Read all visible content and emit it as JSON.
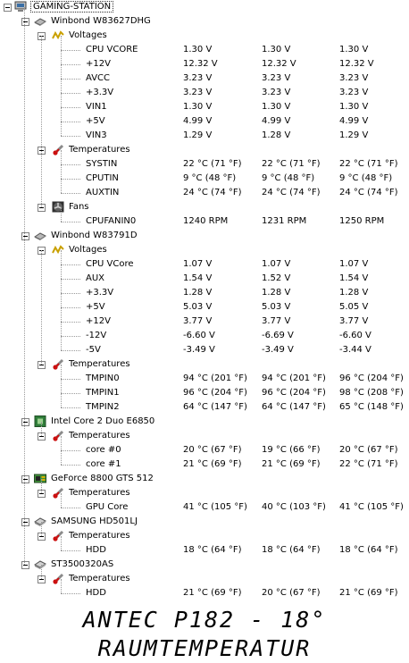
{
  "root": {
    "label": "GAMING-STATION",
    "icon": "computer-icon"
  },
  "devices": [
    {
      "name": "Winbond W83627DHG",
      "icon": "chip-icon",
      "groups": [
        {
          "name": "Voltages",
          "icon": "voltage-icon",
          "rows": [
            [
              "CPU VCORE",
              "1.30 V",
              "1.30 V",
              "1.30 V"
            ],
            [
              "+12V",
              "12.32 V",
              "12.32 V",
              "12.32 V"
            ],
            [
              "AVCC",
              "3.23 V",
              "3.23 V",
              "3.23 V"
            ],
            [
              "+3.3V",
              "3.23 V",
              "3.23 V",
              "3.23 V"
            ],
            [
              "VIN1",
              "1.30 V",
              "1.30 V",
              "1.30 V"
            ],
            [
              "+5V",
              "4.99 V",
              "4.99 V",
              "4.99 V"
            ],
            [
              "VIN3",
              "1.29 V",
              "1.28 V",
              "1.29 V"
            ]
          ]
        },
        {
          "name": "Temperatures",
          "icon": "thermometer-icon",
          "rows": [
            [
              "SYSTIN",
              "22 °C  (71 °F)",
              "22 °C  (71 °F)",
              "22 °C  (71 °F)"
            ],
            [
              "CPUTIN",
              "9 °C  (48 °F)",
              "9 °C  (48 °F)",
              "9 °C  (48 °F)"
            ],
            [
              "AUXTIN",
              "24 °C  (74 °F)",
              "24 °C  (74 °F)",
              "24 °C  (74 °F)"
            ]
          ]
        },
        {
          "name": "Fans",
          "icon": "fan-icon",
          "rows": [
            [
              "CPUFANIN0",
              "1240 RPM",
              "1231 RPM",
              "1250 RPM"
            ]
          ]
        }
      ]
    },
    {
      "name": "Winbond W83791D",
      "icon": "chip-icon",
      "groups": [
        {
          "name": "Voltages",
          "icon": "voltage-icon",
          "rows": [
            [
              "CPU VCore",
              "1.07 V",
              "1.07 V",
              "1.07 V"
            ],
            [
              "AUX",
              "1.54 V",
              "1.52 V",
              "1.54 V"
            ],
            [
              "+3.3V",
              "1.28 V",
              "1.28 V",
              "1.28 V"
            ],
            [
              "+5V",
              "5.03 V",
              "5.03 V",
              "5.05 V"
            ],
            [
              "+12V",
              "3.77 V",
              "3.77 V",
              "3.77 V"
            ],
            [
              "-12V",
              "-6.60 V",
              "-6.69 V",
              "-6.60 V"
            ],
            [
              "-5V",
              "-3.49 V",
              "-3.49 V",
              "-3.44 V"
            ]
          ]
        },
        {
          "name": "Temperatures",
          "icon": "thermometer-icon",
          "rows": [
            [
              "TMPIN0",
              "94 °C  (201 °F)",
              "94 °C  (201 °F)",
              "96 °C  (204 °F)"
            ],
            [
              "TMPIN1",
              "96 °C  (204 °F)",
              "96 °C  (204 °F)",
              "98 °C  (208 °F)"
            ],
            [
              "TMPIN2",
              "64 °C  (147 °F)",
              "64 °C  (147 °F)",
              "65 °C  (148 °F)"
            ]
          ]
        }
      ]
    },
    {
      "name": "Intel Core 2 Duo E6850",
      "icon": "cpu-icon",
      "groups": [
        {
          "name": "Temperatures",
          "icon": "thermometer-icon",
          "rows": [
            [
              "core #0",
              "20 °C  (67 °F)",
              "19 °C  (66 °F)",
              "20 °C  (67 °F)"
            ],
            [
              "core #1",
              "21 °C  (69 °F)",
              "21 °C  (69 °F)",
              "22 °C  (71 °F)"
            ]
          ]
        }
      ]
    },
    {
      "name": "GeForce 8800 GTS 512",
      "icon": "gpu-icon",
      "groups": [
        {
          "name": "Temperatures",
          "icon": "thermometer-icon",
          "rows": [
            [
              "GPU Core",
              "41 °C  (105 °F)",
              "40 °C  (103 °F)",
              "41 °C  (105 °F)"
            ]
          ]
        }
      ]
    },
    {
      "name": "SAMSUNG HD501LJ",
      "icon": "hdd-icon",
      "groups": [
        {
          "name": "Temperatures",
          "icon": "thermometer-icon",
          "rows": [
            [
              "HDD",
              "18 °C  (64 °F)",
              "18 °C  (64 °F)",
              "18 °C  (64 °F)"
            ]
          ]
        }
      ]
    },
    {
      "name": "ST3500320AS",
      "icon": "hdd-icon",
      "groups": [
        {
          "name": "Temperatures",
          "icon": "thermometer-icon",
          "rows": [
            [
              "HDD",
              "21 °C  (69 °F)",
              "20 °C  (67 °F)",
              "21 °C  (69 °F)"
            ]
          ]
        }
      ]
    }
  ],
  "caption": "ANTEC P182 - 18° RAUMTEMPERATUR",
  "colors": {
    "tree_line": "#9a9a9a",
    "background": "#ffffff",
    "text": "#000000"
  }
}
